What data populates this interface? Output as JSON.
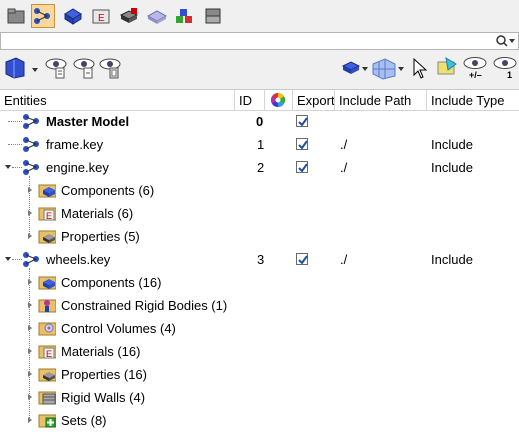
{
  "search": {
    "value": ""
  },
  "columns": {
    "entities": "Entities",
    "id": "ID",
    "export": "Export",
    "include_path": "Include Path",
    "include_type": "Include Type"
  },
  "rows": [
    {
      "label": "Master Model",
      "id": "0",
      "export": true,
      "path": "",
      "type": "",
      "bold": true
    },
    {
      "label": "frame.key",
      "id": "1",
      "export": true,
      "path": "./",
      "type": "Include"
    },
    {
      "label": "engine.key",
      "id": "2",
      "export": true,
      "path": "./",
      "type": "Include"
    },
    {
      "label": "Components (6)"
    },
    {
      "label": "Materials (6)"
    },
    {
      "label": "Properties (5)"
    },
    {
      "label": "wheels.key",
      "id": "3",
      "export": true,
      "path": "./",
      "type": "Include"
    },
    {
      "label": "Components (16)"
    },
    {
      "label": "Constrained Rigid Bodies (1)"
    },
    {
      "label": "Control Volumes (4)"
    },
    {
      "label": "Materials (16)"
    },
    {
      "label": "Properties (16)"
    },
    {
      "label": "Rigid Walls (4)"
    },
    {
      "label": "Sets (8)"
    }
  ],
  "icons": {
    "toolbar1": [
      "folder-gray-icon",
      "model-tree-icon",
      "components-icon",
      "materials-icon",
      "properties-icon",
      "groups-icon",
      "sets-icon",
      "box-icon"
    ],
    "toolbar2_left": [
      "entity-view-icon",
      "show-list-icon",
      "show-tree-icon",
      "show-flat-icon"
    ],
    "toolbar2_right": [
      "solid-mode-icon",
      "mesh-mode-icon",
      "cursor-icon",
      "fill-icon",
      "show-plus-minus-icon",
      "show-one-icon"
    ]
  },
  "toolbar2_badges": {
    "plus_minus": "+/–",
    "one": "1"
  },
  "colors": {
    "selected_tab": "#fbd79a",
    "link_blue": "#1e4fa0",
    "components_blue": "#2a4fc8",
    "sets_green": "#2fa52f"
  }
}
